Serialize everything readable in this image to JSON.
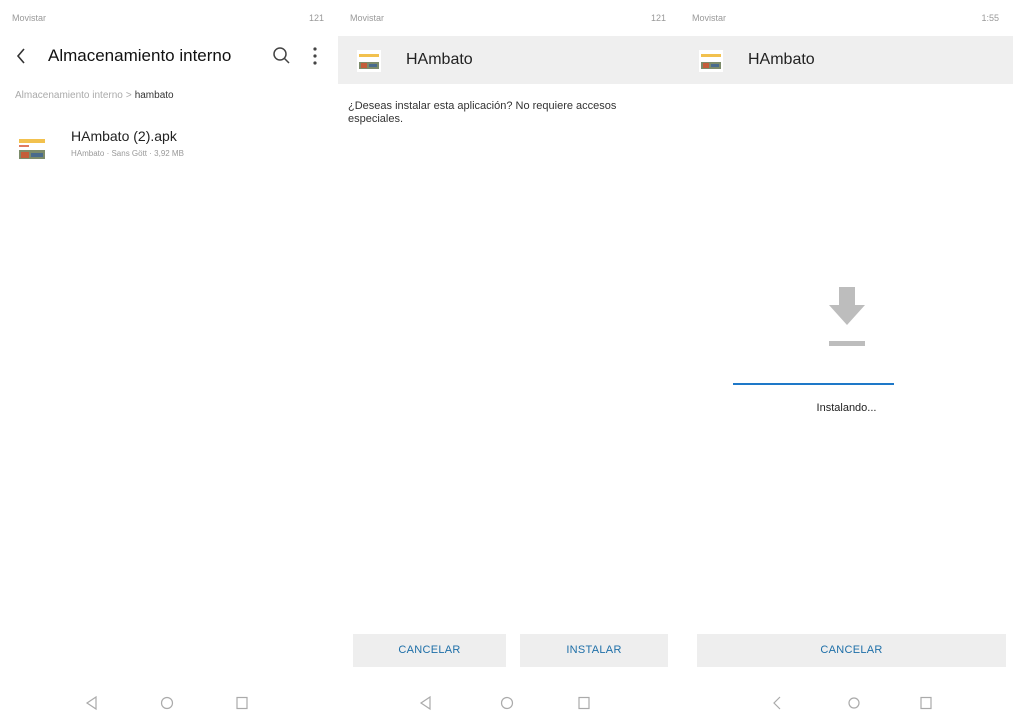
{
  "colors": {
    "accent": "#1e6fa8",
    "progress": "#1e78c8",
    "header_bg": "#efefef",
    "button_bg": "#eeeeee"
  },
  "panels": [
    {
      "status_bar": {
        "carrier": "Movistar",
        "right": "121"
      },
      "title": "Almacenamiento interno",
      "breadcrumb": {
        "root": "Almacenamiento interno",
        "separator": ">",
        "current": "hambato"
      },
      "file": {
        "name": "HAmbato (2).apk",
        "meta": "HAmbato · Sans Gött · 3,92 MB"
      },
      "icons": [
        "back-arrow-icon",
        "search-icon",
        "more-vert-icon",
        "apk-file-icon"
      ]
    },
    {
      "status_bar": {
        "carrier": "Movistar",
        "right": "121"
      },
      "app_name": "HAmbato",
      "question": "¿Deseas instalar esta aplicación? No requiere accesos especiales.",
      "buttons": {
        "cancel": "CANCELAR",
        "install": "INSTALAR"
      },
      "icons": [
        "app-icon"
      ]
    },
    {
      "status_bar": {
        "carrier": "Movistar",
        "right": "1:55"
      },
      "app_name": "HAmbato",
      "status_text": "Instalando...",
      "progress_fraction": 1.0,
      "buttons": {
        "cancel": "CANCELAR"
      },
      "icons": [
        "app-icon",
        "download-icon"
      ]
    }
  ],
  "navigation_bar": {
    "icons": [
      "nav-back-icon",
      "nav-home-icon",
      "nav-recents-icon"
    ]
  }
}
